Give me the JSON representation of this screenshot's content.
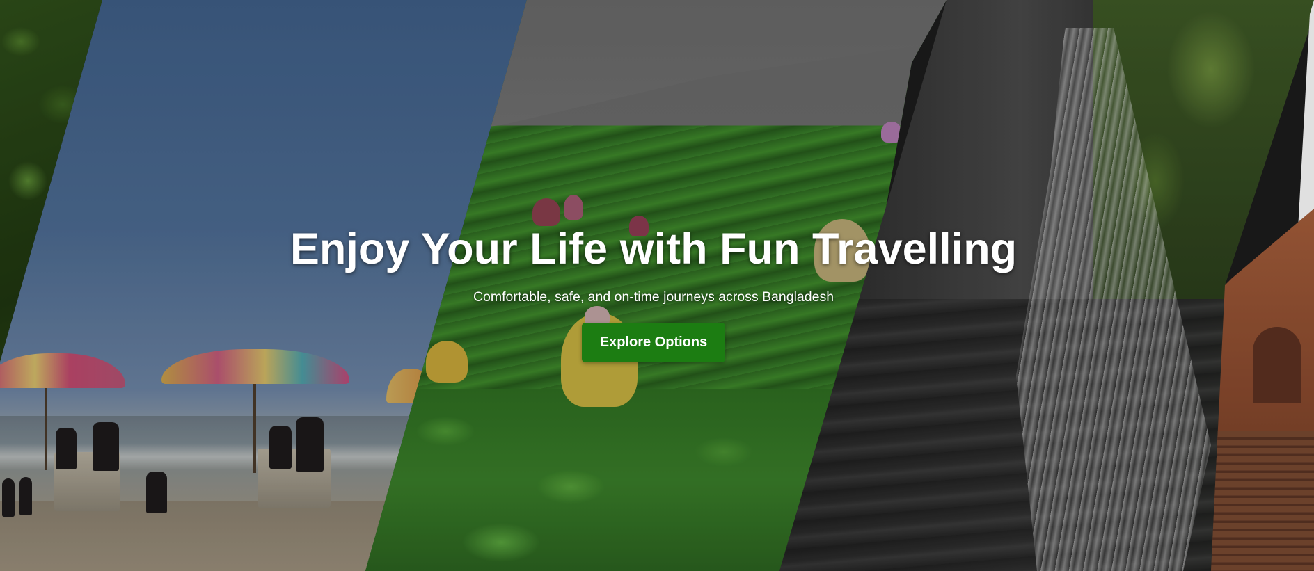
{
  "hero": {
    "title": "Enjoy Your Life with Fun Travelling",
    "subtitle": "Comfortable, safe, and on-time journeys across Bangladesh",
    "cta_label": "Explore Options",
    "cta_color": "#1c7d12",
    "text_color": "#ffffff"
  },
  "background_panels": [
    {
      "name": "forest"
    },
    {
      "name": "beach"
    },
    {
      "name": "tea-garden"
    },
    {
      "name": "waterfall"
    },
    {
      "name": "heritage-building"
    }
  ]
}
